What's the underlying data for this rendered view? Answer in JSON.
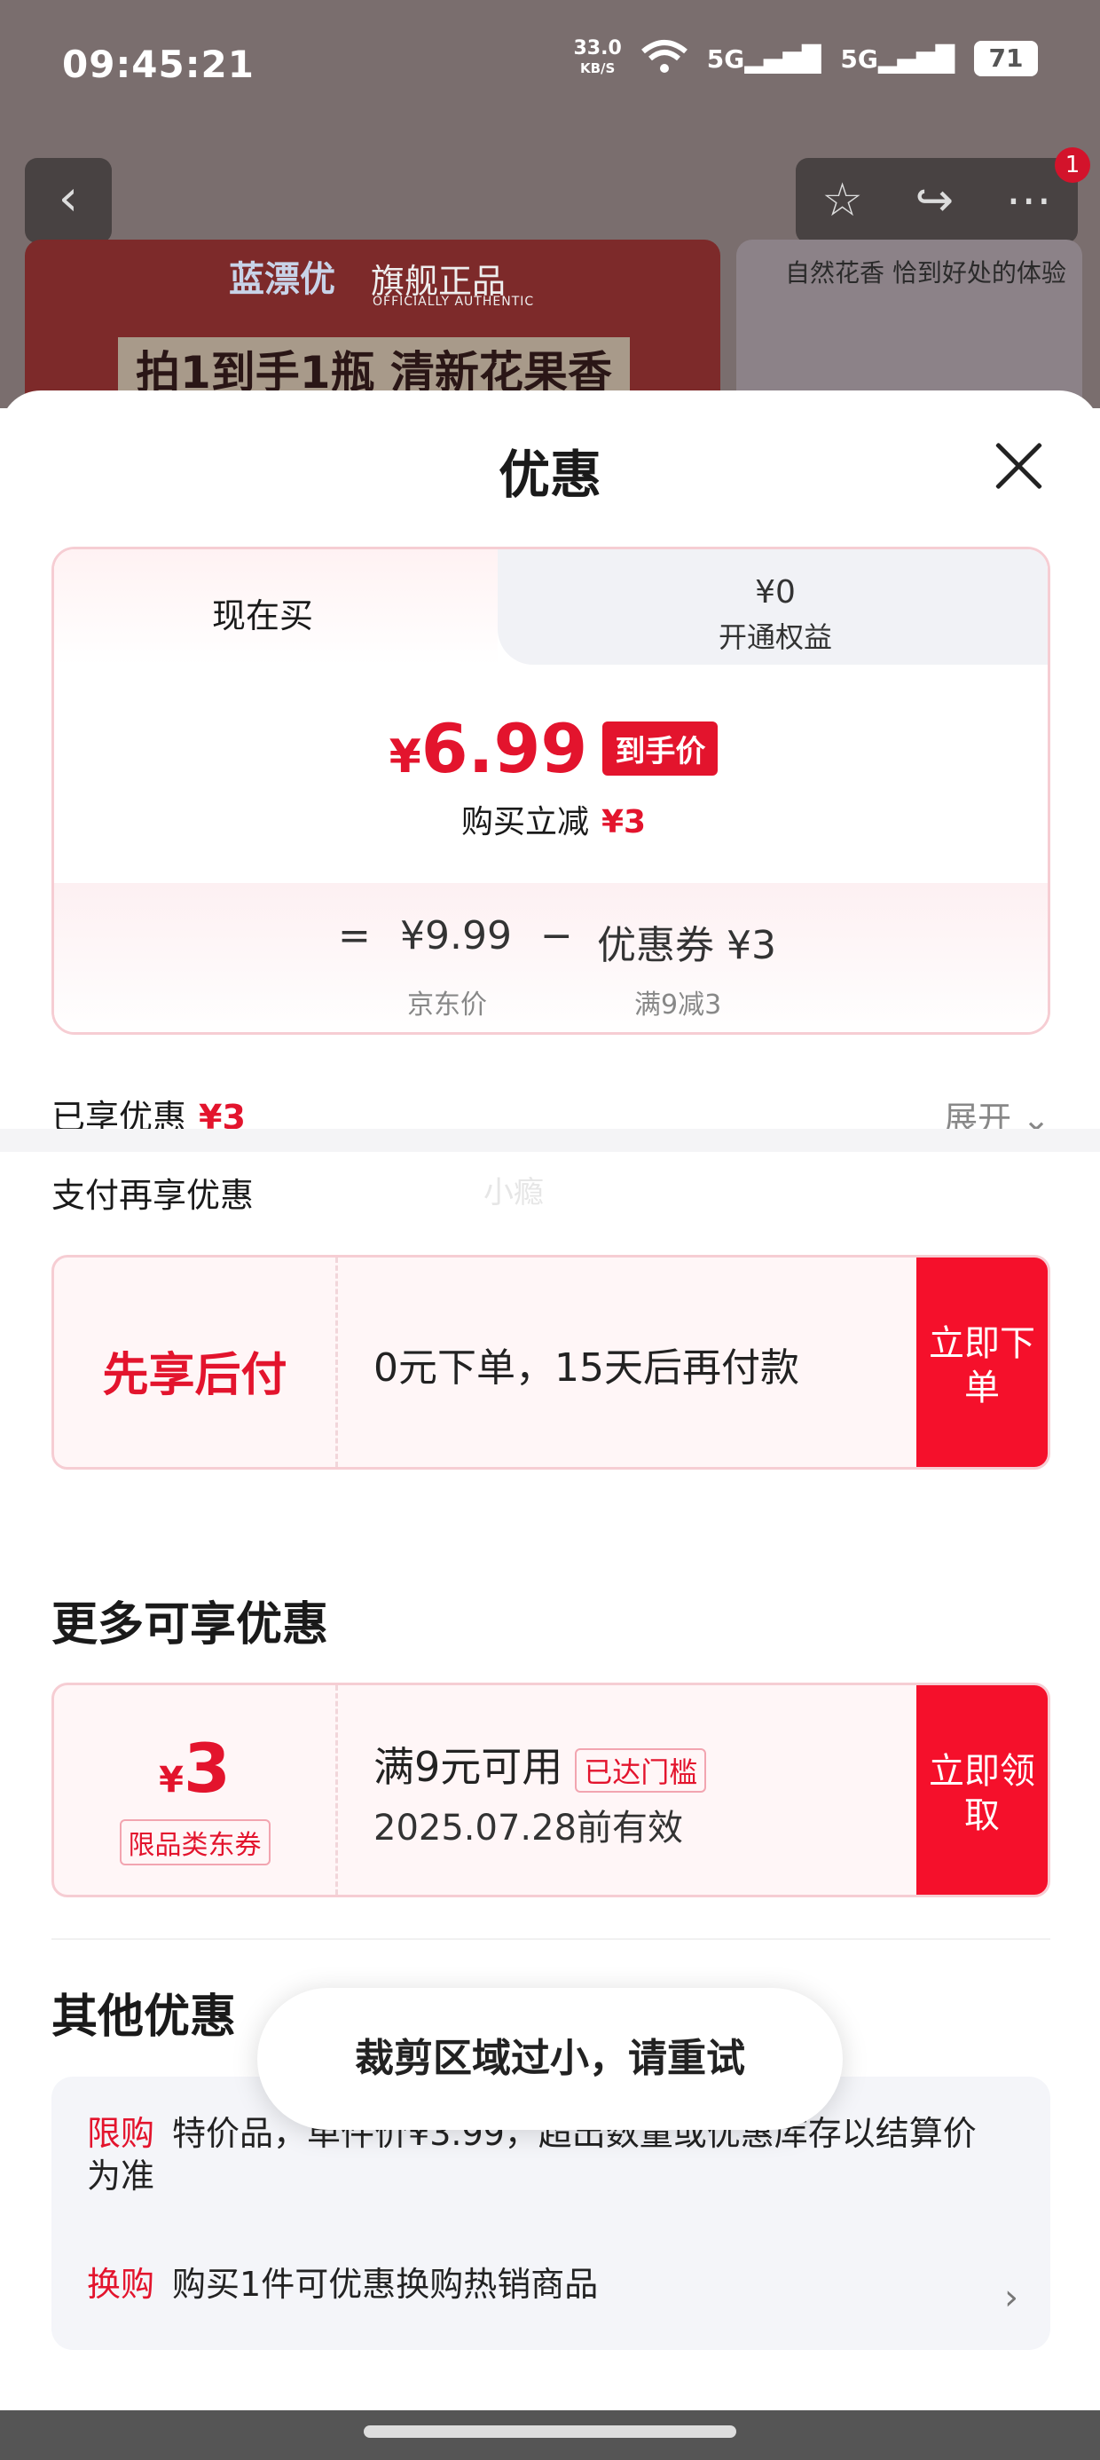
{
  "status_bar": {
    "time": "09:45:21",
    "net_speed": "33.0",
    "net_unit": "KB/S",
    "signal1": "5G",
    "signal2": "5G",
    "battery": "71"
  },
  "background": {
    "badge_count": "1",
    "brand": "蓝漂优",
    "tag": "旗舰正品",
    "tag_sub": "OFFICIALLY AUTHENTIC",
    "slogan": "拍1到手1瓶 清新花果香",
    "side_text": "自然花香 恰到好处的体验"
  },
  "sheet": {
    "title": "优惠",
    "tabs": [
      {
        "label": "现在买"
      },
      {
        "value": "¥0",
        "label": "开通权益"
      }
    ],
    "price": {
      "currency": "¥",
      "amount": "6.99",
      "tag": "到手价",
      "reduce_label": "购买立减",
      "reduce_value": "¥3"
    },
    "calc": {
      "equals": "=",
      "base_price": "¥9.99",
      "minus": "−",
      "coupon": "优惠券 ¥3",
      "base_label": "京东价",
      "coupon_label": "满9减3"
    },
    "enjoyed_label": "已享优惠",
    "enjoyed_value": "¥3",
    "expand_label": "展开",
    "pay_more_label": "支付再享优惠",
    "watermark": "小瘾",
    "pay_later": {
      "label": "先享后付",
      "text": "0元下单，15天后再付款",
      "button": "立即下单"
    },
    "more_title": "更多可享优惠",
    "jd_coupon": {
      "currency": "¥",
      "amount": "3",
      "type": "限品类东券",
      "condition": "满9元可用",
      "badge": "已达门槛",
      "expiry": "2025.07.28前有效",
      "button": "立即领取"
    },
    "others_title": "其他优惠",
    "others": [
      {
        "tag": "限购",
        "text": "特价品，单件价¥3.99，超出数量或优惠库存以结算价为准"
      },
      {
        "tag": "换购",
        "text": "购买1件可优惠换购热销商品"
      }
    ],
    "toast": "裁剪区域过小，请重试"
  }
}
